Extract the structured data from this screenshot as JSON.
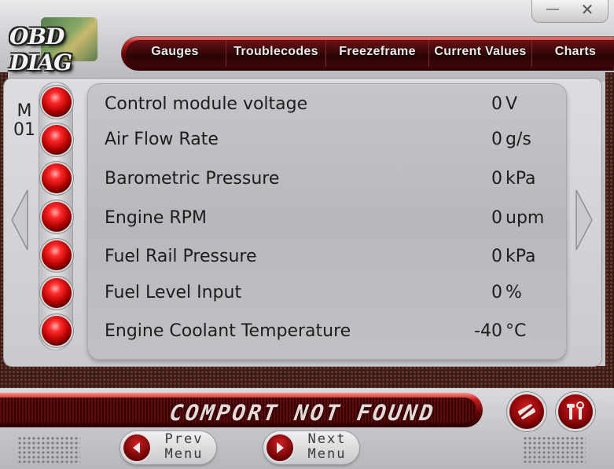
{
  "app": {
    "logo_text": "OBD DIAG"
  },
  "window_controls": {
    "minimize": "—",
    "close": "✕"
  },
  "tabs": [
    {
      "label": "Gauges"
    },
    {
      "label": "Troublecodes"
    },
    {
      "label": "Freezeframe"
    },
    {
      "label": "Current Values"
    },
    {
      "label": "Charts"
    }
  ],
  "mode": {
    "line1": "M",
    "line2": "01"
  },
  "rows": [
    {
      "name": "Control module voltage",
      "value": "0",
      "unit": "V"
    },
    {
      "name": "Air Flow Rate",
      "value": "0",
      "unit": "g/s"
    },
    {
      "name": "Barometric Pressure",
      "value": "0",
      "unit": "kPa"
    },
    {
      "name": "Engine RPM",
      "value": "0",
      "unit": "upm"
    },
    {
      "name": "Fuel Rail Pressure",
      "value": "0",
      "unit": "kPa"
    },
    {
      "name": "Fuel Level Input",
      "value": "0",
      "unit": "%"
    },
    {
      "name": "Engine Coolant Temperature",
      "value": "-40",
      "unit": "°C"
    }
  ],
  "status": {
    "text": "COMPORT NOT FOUND"
  },
  "buttons": {
    "prev": {
      "line1": "Prev",
      "line2": "Menu"
    },
    "next": {
      "line1": "Next",
      "line2": "Menu"
    },
    "connect_icon": "disconnect-icon",
    "settings_icon": "tools-icon"
  },
  "colors": {
    "accent": "#c71f22",
    "dark_red": "#5e0506",
    "panel": "#c9cacd"
  }
}
